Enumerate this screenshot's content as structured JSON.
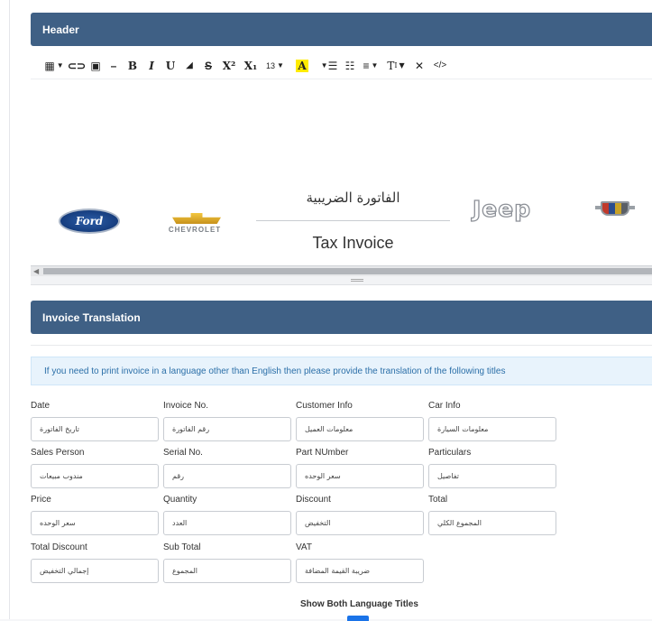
{
  "header_section": {
    "title": "Header",
    "toolbar": [
      {
        "name": "table-icon",
        "glyph": "▦",
        "caret": true
      },
      {
        "name": "link-icon",
        "glyph": "⊂⊃",
        "caret": false
      },
      {
        "name": "picture-icon",
        "glyph": "▣",
        "caret": false
      },
      {
        "name": "horizontal-rule-icon",
        "glyph": "—",
        "caret": false
      },
      {
        "name": "bold-icon",
        "glyph": "B",
        "caret": false
      },
      {
        "name": "italic-icon",
        "glyph": "I",
        "caret": false
      },
      {
        "name": "underline-icon",
        "glyph": "U",
        "caret": false
      },
      {
        "name": "eraser-icon",
        "glyph": "⌫",
        "caret": false
      },
      {
        "name": "strikethrough-icon",
        "glyph": "S",
        "caret": false
      },
      {
        "name": "superscript-icon",
        "glyph": "X²",
        "caret": false
      },
      {
        "name": "subscript-icon",
        "glyph": "X₂",
        "caret": false
      },
      {
        "name": "font-size-icon",
        "glyph": "13",
        "caret": true
      },
      {
        "name": "text-color-icon",
        "glyph": "A",
        "caret": true
      },
      {
        "name": "unordered-list-icon",
        "glyph": "☰",
        "caret": false
      },
      {
        "name": "ordered-list-icon",
        "glyph": "☷",
        "caret": false
      },
      {
        "name": "paragraph-icon",
        "glyph": "≡",
        "caret": true
      },
      {
        "name": "style-icon",
        "glyph": "TI",
        "caret": true
      },
      {
        "name": "fullscreen-icon",
        "glyph": "⤧",
        "caret": false
      },
      {
        "name": "code-view-icon",
        "glyph": "</>",
        "caret": false
      }
    ],
    "content": {
      "logo_ford": "Ford",
      "logo_chevrolet": "CHEVROLET",
      "title_arabic": "الفاتورة الضريبية",
      "title_english": "Tax Invoice",
      "logo_jeep": "Jeep"
    }
  },
  "translation_section": {
    "title": "Invoice Translation",
    "info": "If you need to print invoice in a language other than English then please provide the translation of the following titles",
    "fields": [
      {
        "label": "Date",
        "value": "تاريخ الفاتورة"
      },
      {
        "label": "Invoice No.",
        "value": "رقم الفاتورة"
      },
      {
        "label": "Customer Info",
        "value": "معلومات العميل"
      },
      {
        "label": "Car Info",
        "value": "معلومات السيارة"
      },
      {
        "label": "Sales Person",
        "value": "مندوب مبيعات"
      },
      {
        "label": "Serial No.",
        "value": "رقم"
      },
      {
        "label": "Part NUmber",
        "value": "سعر الوحده"
      },
      {
        "label": "Particulars",
        "value": "تفاصيل"
      },
      {
        "label": "Price",
        "value": "سعر الوحده"
      },
      {
        "label": "Quantity",
        "value": "العدد"
      },
      {
        "label": "Discount",
        "value": "التخفيض"
      },
      {
        "label": "Total",
        "value": "المجموع الكلي"
      },
      {
        "label": "Total Discount",
        "value": "إجمالي التخفيض"
      },
      {
        "label": "Sub Total",
        "value": "المجموع"
      },
      {
        "label": "VAT",
        "value": "ضريبة القيمة المضافة"
      }
    ],
    "show_both_label": "Show Both Language Titles"
  },
  "colors": {
    "panel_header": "#3f6085",
    "info_bg": "#e8f3fc",
    "info_text": "#2b6fa8",
    "toggle": "#1a73e8"
  }
}
